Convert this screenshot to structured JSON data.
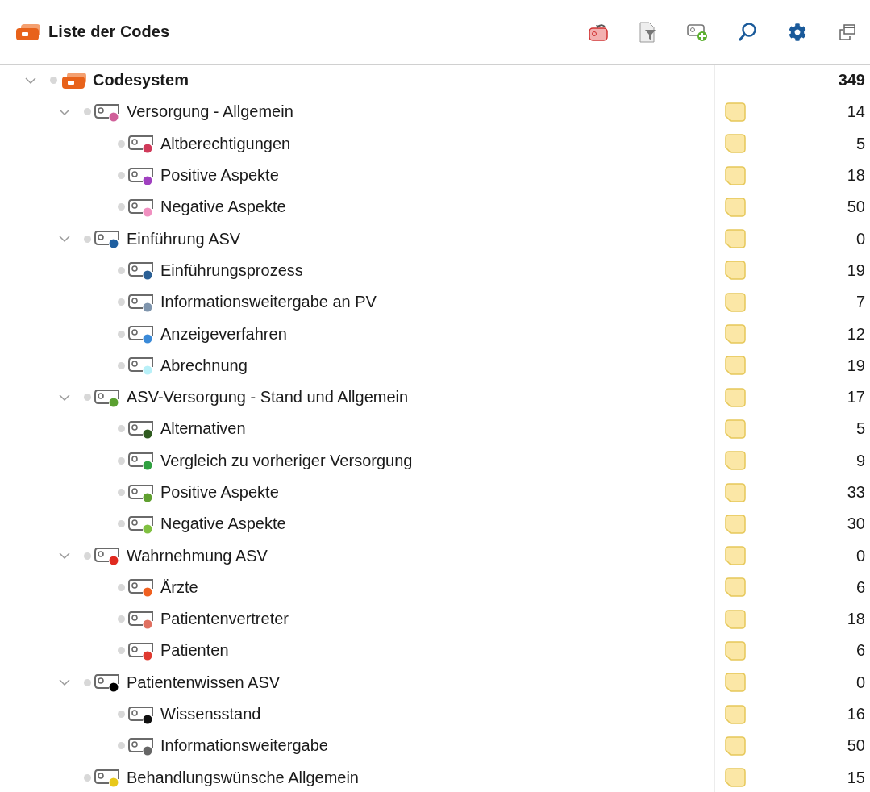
{
  "panel": {
    "title": "Liste der Codes"
  },
  "tree": {
    "label": "Codesystem",
    "count": "349",
    "expanded": true,
    "memo": false,
    "children": [
      {
        "label": "Versorgung - Allgemein",
        "color": "#d0609a",
        "count": "14",
        "memo": true,
        "expanded": true,
        "children": [
          {
            "label": "Altberechtigungen",
            "color": "#d03a5a",
            "count": "5",
            "memo": true
          },
          {
            "label": "Positive Aspekte",
            "color": "#a040c0",
            "count": "18",
            "memo": true
          },
          {
            "label": "Negative Aspekte",
            "color": "#f090c0",
            "count": "50",
            "memo": true
          }
        ]
      },
      {
        "label": "Einführung ASV",
        "color": "#1f5fa0",
        "count": "0",
        "memo": true,
        "expanded": true,
        "children": [
          {
            "label": "Einführungsprozess",
            "color": "#2a5f95",
            "count": "19",
            "memo": true
          },
          {
            "label": "Informationsweitergabe an PV",
            "color": "#7f95ad",
            "count": "7",
            "memo": true
          },
          {
            "label": "Anzeigeverfahren",
            "color": "#3a8ad8",
            "count": "12",
            "memo": true
          },
          {
            "label": "Abrechnung",
            "color": "#b8f0f8",
            "count": "19",
            "memo": true
          }
        ]
      },
      {
        "label": "ASV-Versorgung - Stand und Allgemein",
        "color": "#5aa030",
        "count": "17",
        "memo": true,
        "expanded": true,
        "children": [
          {
            "label": "Alternativen",
            "color": "#2f5a1f",
            "count": "5",
            "memo": true
          },
          {
            "label": "Vergleich zu vorheriger Versorgung",
            "color": "#30a040",
            "count": "9",
            "memo": true
          },
          {
            "label": "Positive Aspekte",
            "color": "#60a030",
            "count": "33",
            "memo": true
          },
          {
            "label": "Negative Aspekte",
            "color": "#80c040",
            "count": "30",
            "memo": true
          }
        ]
      },
      {
        "label": "Wahrnehmung ASV",
        "color": "#e02a20",
        "count": "0",
        "memo": true,
        "expanded": true,
        "children": [
          {
            "label": "Ärzte",
            "color": "#f06020",
            "count": "6",
            "memo": true
          },
          {
            "label": "Patientenvertreter",
            "color": "#e07060",
            "count": "18",
            "memo": true
          },
          {
            "label": "Patienten",
            "color": "#e03a30",
            "count": "6",
            "memo": true
          }
        ]
      },
      {
        "label": "Patientenwissen ASV",
        "color": "#000000",
        "count": "0",
        "memo": true,
        "expanded": true,
        "children": [
          {
            "label": "Wissensstand",
            "color": "#101010",
            "count": "16",
            "memo": true
          },
          {
            "label": "Informationsweitergabe",
            "color": "#666666",
            "count": "50",
            "memo": true
          }
        ]
      },
      {
        "label": "Behandlungswünsche Allgemein",
        "color": "#e8c81a",
        "count": "15",
        "memo": true
      }
    ]
  }
}
